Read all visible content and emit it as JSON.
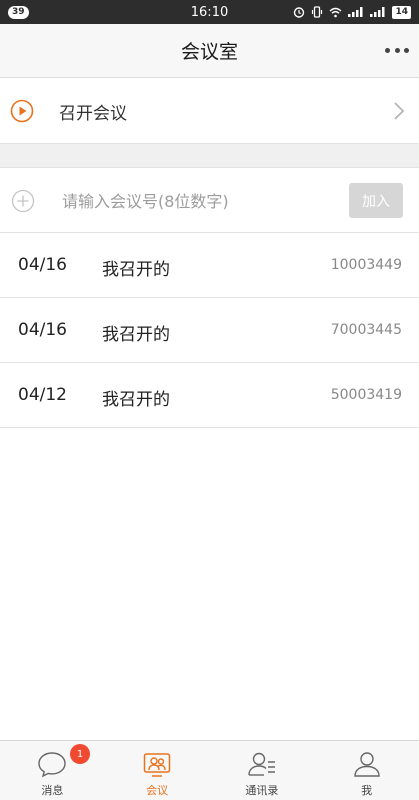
{
  "status_bar": {
    "notification_count": "39",
    "time": "16:10",
    "battery": "14"
  },
  "header": {
    "title": "会议室"
  },
  "start_meeting": {
    "label": "召开会议"
  },
  "join": {
    "placeholder": "请输入会议号(8位数字)",
    "button_label": "加入"
  },
  "meetings": [
    {
      "date": "04/16",
      "title": "我召开的",
      "id": "10003449"
    },
    {
      "date": "04/16",
      "title": "我召开的",
      "id": "70003445"
    },
    {
      "date": "04/12",
      "title": "我召开的",
      "id": "50003419"
    }
  ],
  "tabbar": {
    "tabs": [
      {
        "label": "消息",
        "icon": "chat-bubble-icon",
        "badge": "1"
      },
      {
        "label": "会议",
        "icon": "meeting-icon",
        "active": true
      },
      {
        "label": "通讯录",
        "icon": "contacts-icon"
      },
      {
        "label": "我",
        "icon": "profile-icon"
      }
    ]
  },
  "colors": {
    "accent": "#e8731e",
    "badge": "#f04a31",
    "disabled_button": "#d6d6d6"
  }
}
